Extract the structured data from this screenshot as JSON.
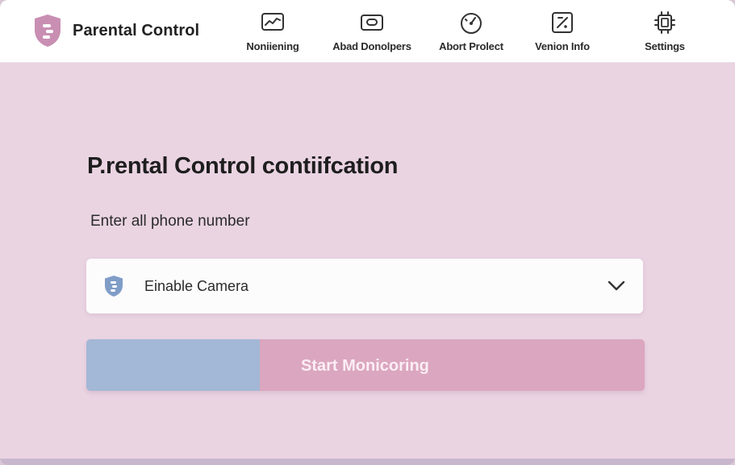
{
  "app": {
    "title": "Parental Control",
    "logo_icon": "shield-logo-icon",
    "brand_color": "#c98fb3"
  },
  "nav": {
    "items": [
      {
        "label": "Noniiening",
        "icon": "monitoring-chart-icon"
      },
      {
        "label": "Abad Donolpers",
        "icon": "developers-card-icon"
      },
      {
        "label": "Abort Prolect",
        "icon": "project-gauge-icon"
      },
      {
        "label": "Venion Info",
        "icon": "version-info-icon"
      },
      {
        "label": "Settings",
        "icon": "settings-device-icon"
      }
    ]
  },
  "main": {
    "title": "P.rental Control contiifcation",
    "subtitle": "Enter all phone number",
    "select": {
      "value": "Einable Camera",
      "icon": "shield-icon"
    },
    "action_button": {
      "label": "Start Monicoring",
      "progress": 0.31,
      "fill_color": "#a3b7d6",
      "track_color": "#dba6bf"
    }
  },
  "colors": {
    "background": "#ead4e2",
    "header": "#ffffff"
  }
}
